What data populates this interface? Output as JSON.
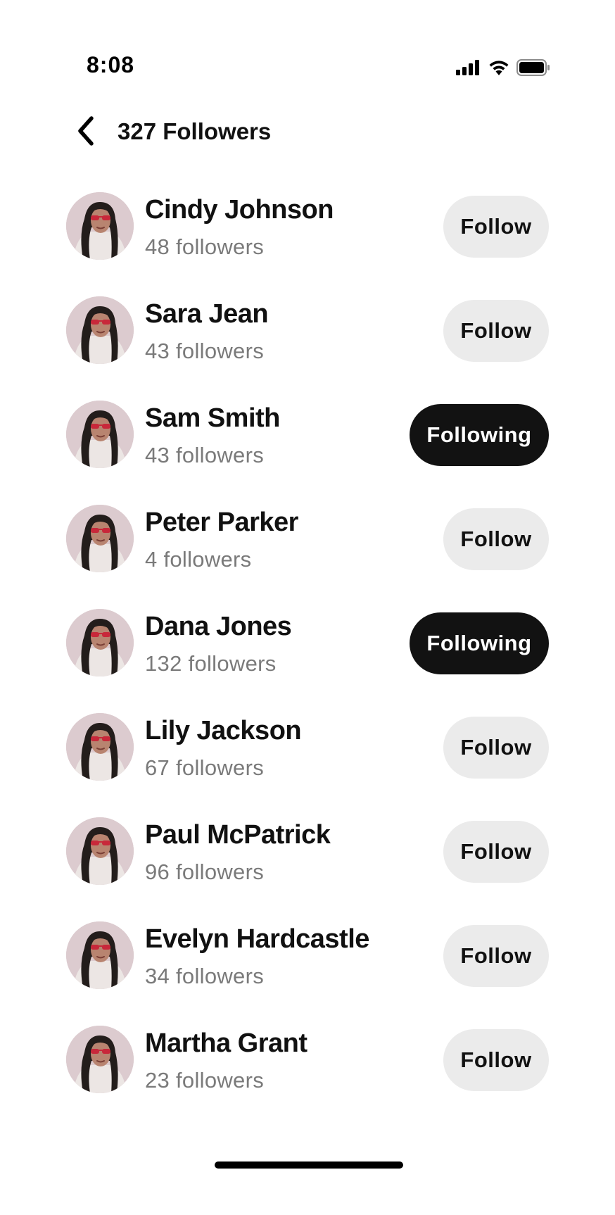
{
  "status_bar": {
    "time": "8:08",
    "icons": [
      "signal-icon",
      "wifi-icon",
      "battery-icon"
    ]
  },
  "header": {
    "back_icon": "chevron-left-icon",
    "title": "327 Followers"
  },
  "followers": [
    {
      "name": "Cindy Johnson",
      "followers": "48 followers",
      "button": "Follow",
      "following": false
    },
    {
      "name": "Sara Jean",
      "followers": "43 followers",
      "button": "Follow",
      "following": false
    },
    {
      "name": "Sam Smith",
      "followers": "43 followers",
      "button": "Following",
      "following": true
    },
    {
      "name": "Peter Parker",
      "followers": "4 followers",
      "button": "Follow",
      "following": false
    },
    {
      "name": "Dana Jones",
      "followers": "132 followers",
      "button": "Following",
      "following": true
    },
    {
      "name": "Lily Jackson",
      "followers": "67 followers",
      "button": "Follow",
      "following": false
    },
    {
      "name": "Paul McPatrick",
      "followers": "96 followers",
      "button": "Follow",
      "following": false
    },
    {
      "name": "Evelyn Hardcastle",
      "followers": "34 followers",
      "button": "Follow",
      "following": false
    },
    {
      "name": "Martha Grant",
      "followers": "23 followers",
      "button": "Follow",
      "following": false
    }
  ],
  "colors": {
    "follow_bg": "#ebebeb",
    "following_bg": "#121212",
    "secondary_text": "#7a7a7a"
  }
}
